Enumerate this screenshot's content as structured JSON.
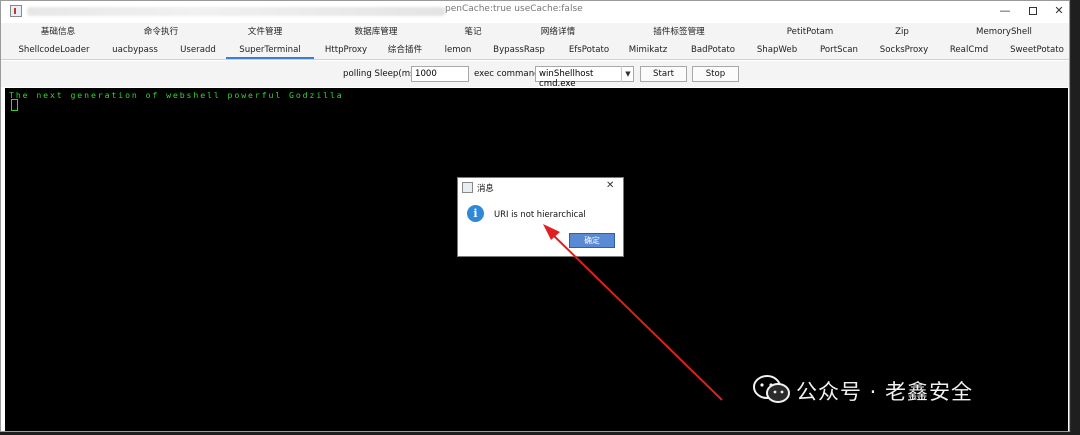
{
  "window": {
    "title_visible": "penCache:true useCache:false",
    "min_glyph": "—",
    "close_glyph": "✕"
  },
  "tabs_row1": [
    {
      "label": "基础信息"
    },
    {
      "label": "命令执行"
    },
    {
      "label": "文件管理"
    },
    {
      "label": "数据库管理"
    },
    {
      "label": "笔记"
    },
    {
      "label": "网络详情"
    },
    {
      "label": "插件标签管理"
    },
    {
      "label": "PetitPotam"
    },
    {
      "label": "Zip"
    },
    {
      "label": "MemoryShell"
    }
  ],
  "tabs_row2": [
    {
      "label": "ShellcodeLoader"
    },
    {
      "label": "uacbypass"
    },
    {
      "label": "Useradd"
    },
    {
      "label": "SuperTerminal",
      "active": true
    },
    {
      "label": "HttpProxy"
    },
    {
      "label": "综合插件"
    },
    {
      "label": "lemon"
    },
    {
      "label": "BypassRasp"
    },
    {
      "label": "EfsPotato"
    },
    {
      "label": "Mimikatz"
    },
    {
      "label": "BadPotato"
    },
    {
      "label": "ShapWeb"
    },
    {
      "label": "PortScan"
    },
    {
      "label": "SocksProxy"
    },
    {
      "label": "RealCmd"
    },
    {
      "label": "SweetPotato"
    }
  ],
  "toolbar": {
    "polling_label": "polling Sleep(ms)",
    "polling_value": "1000",
    "exec_label": "exec command",
    "exec_value": "winShellhost cmd.exe",
    "start_label": "Start",
    "stop_label": "Stop"
  },
  "terminal": {
    "line": "The next generation of webshell powerful Godzilla",
    "text_color": "#33d633",
    "background": "#000000"
  },
  "dialog": {
    "title": "消息",
    "message": "URI is not hierarchical",
    "ok_label": "确定",
    "close_glyph": "✕",
    "info_glyph": "i"
  },
  "annotation": {
    "arrow_color": "#e0201e"
  },
  "watermark": {
    "text": "公众号 · 老鑫安全"
  },
  "colors": {
    "accent": "#3b7dd8",
    "dialog_button": "#5b8ad4"
  }
}
